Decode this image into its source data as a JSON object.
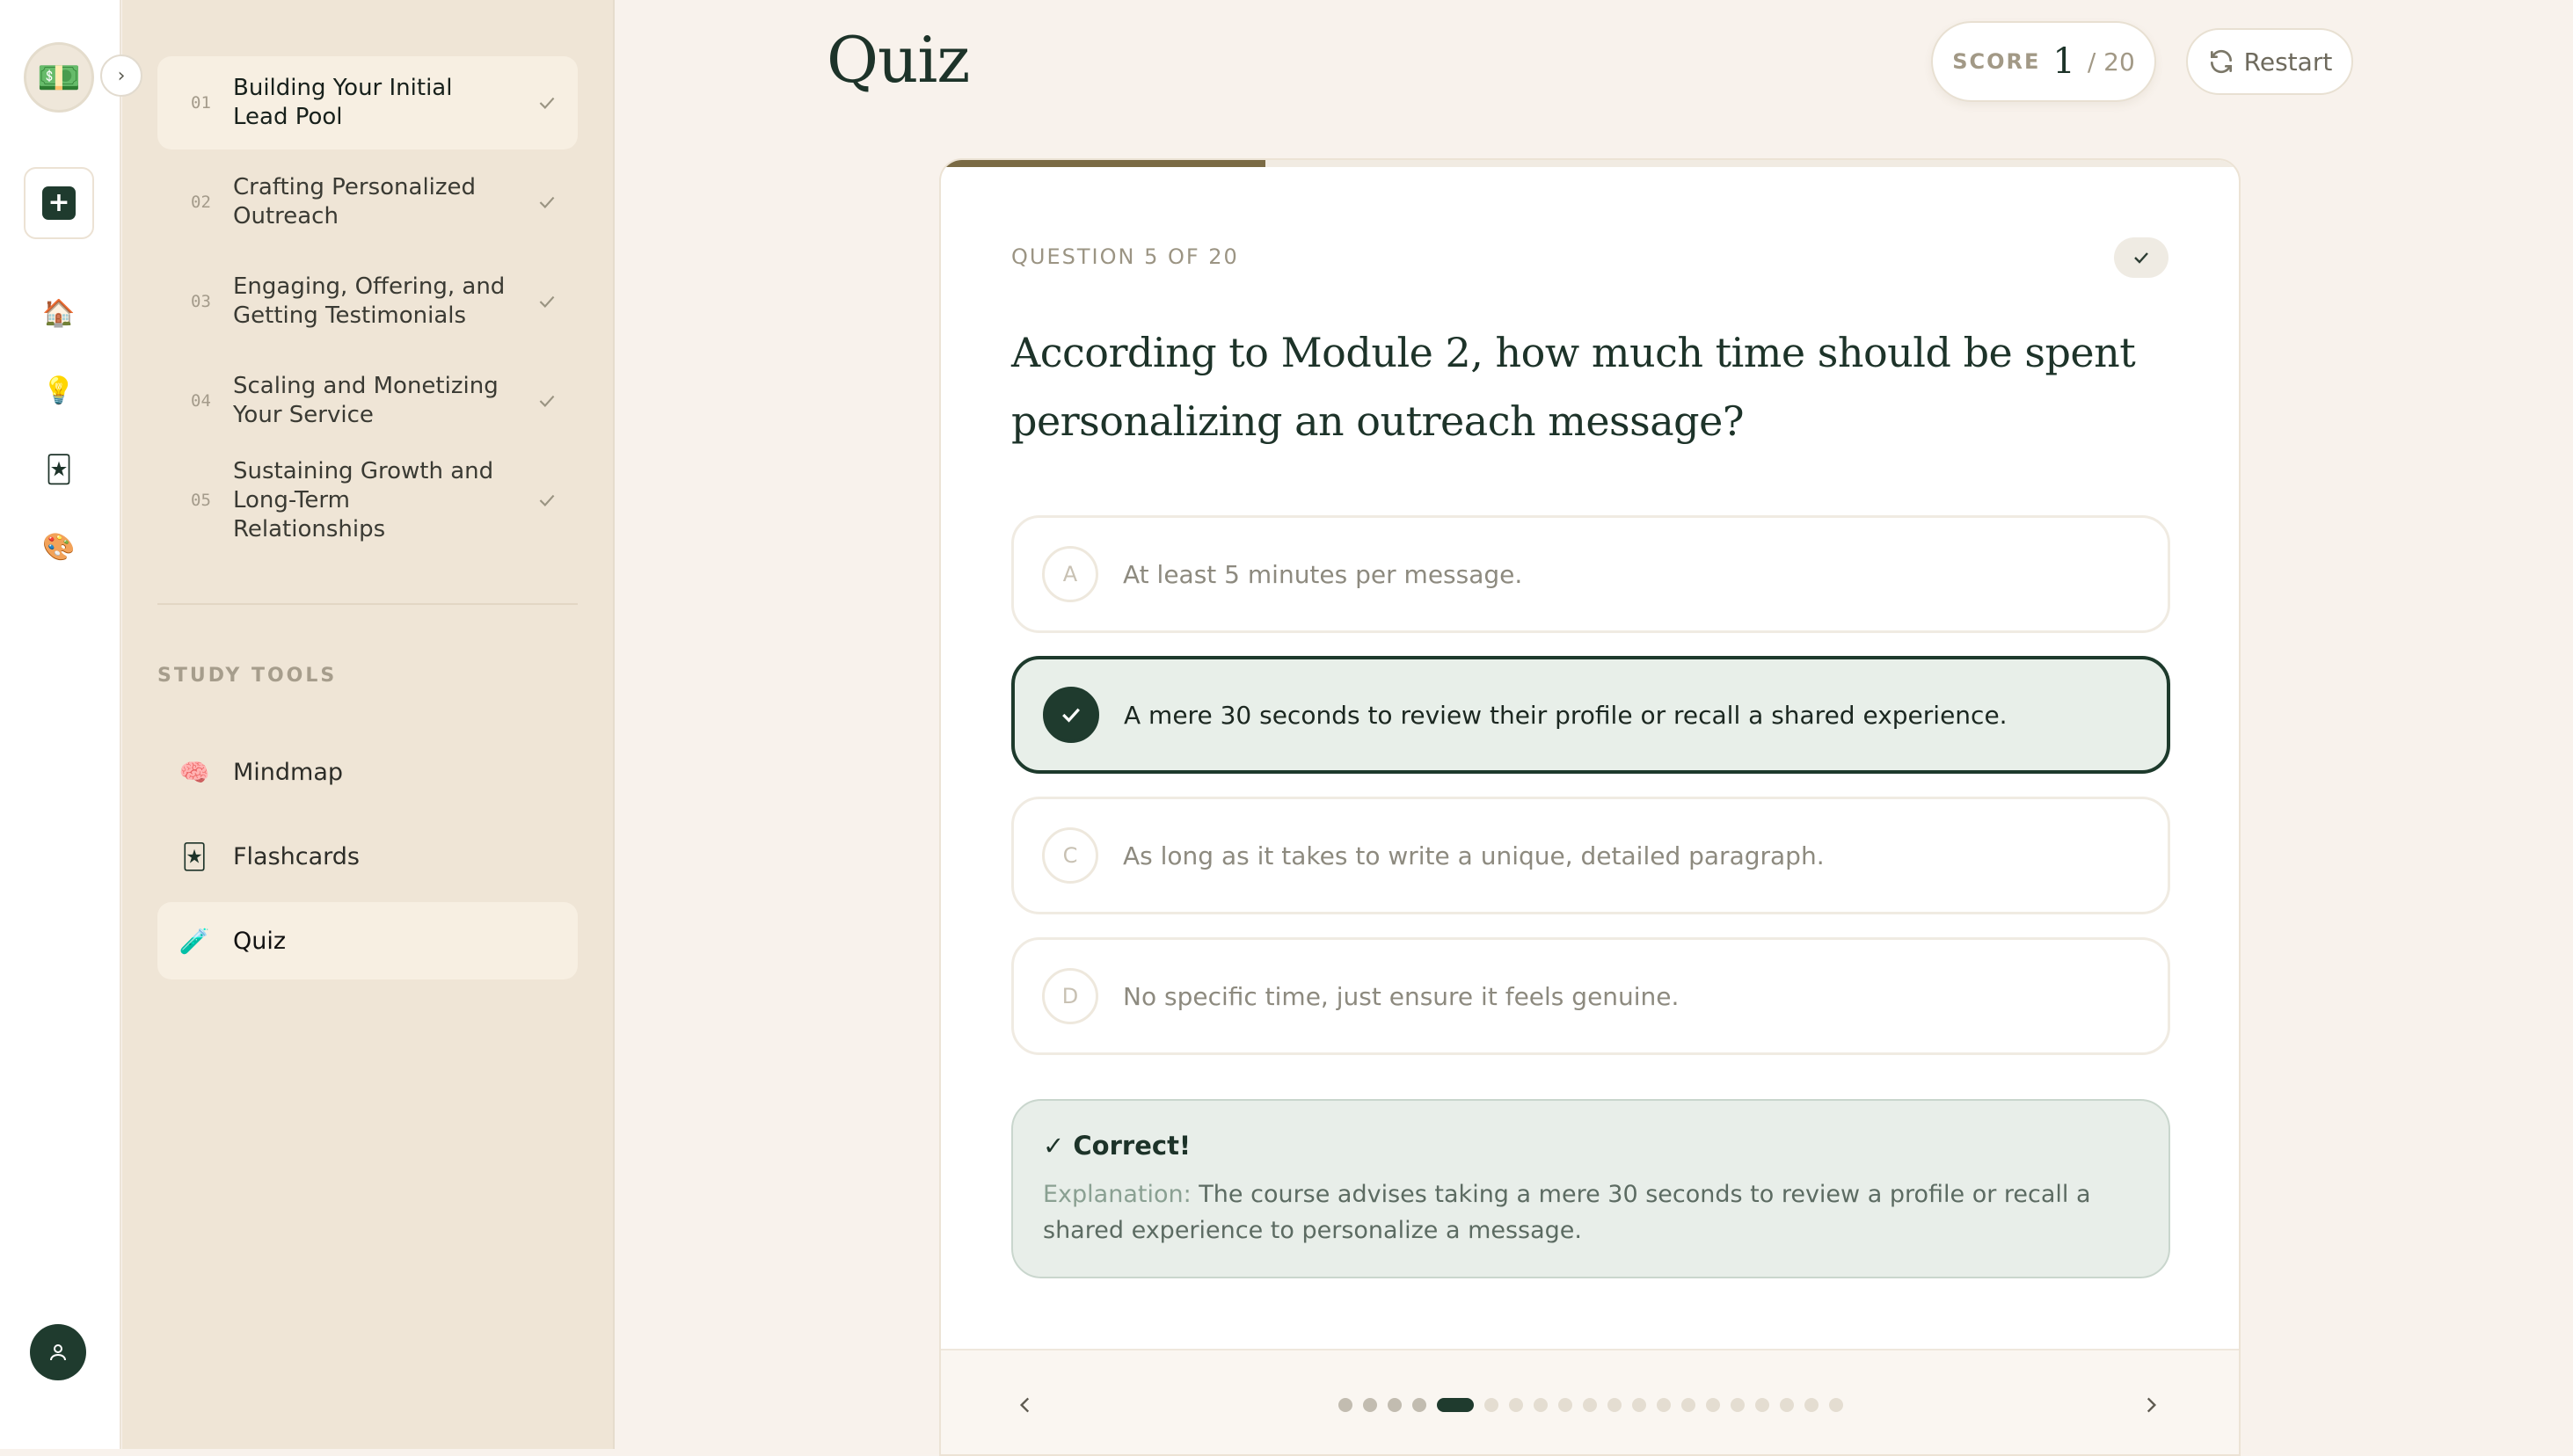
{
  "rail": {
    "logo_glyph": "💵",
    "expand_glyph": "›",
    "new_glyph": "+",
    "icons": [
      "home-icon",
      "lightbulb-icon",
      "flashcard-icon",
      "palette-icon"
    ],
    "icon_glyphs": [
      "🏠",
      "💡",
      "🃏",
      "🎨"
    ]
  },
  "sidebar": {
    "modules": [
      {
        "num": "01",
        "title": "Building Your Initial Lead Pool",
        "completed": true
      },
      {
        "num": "02",
        "title": "Crafting Personalized Outreach",
        "completed": true
      },
      {
        "num": "03",
        "title": "Engaging, Offering, and Getting Testimonials",
        "completed": true
      },
      {
        "num": "04",
        "title": "Scaling and Monetizing Your Service",
        "completed": true
      },
      {
        "num": "05",
        "title": "Sustaining Growth and Long-Term Relationships",
        "completed": true
      }
    ],
    "tools_label": "STUDY TOOLS",
    "tools": [
      {
        "label": "Mindmap",
        "glyph": "🧠"
      },
      {
        "label": "Flashcards",
        "glyph": "🃏"
      },
      {
        "label": "Quiz",
        "glyph": "🧪"
      }
    ]
  },
  "header": {
    "title": "Quiz",
    "score_label": "SCORE",
    "score_value": "1",
    "score_total": "/ 20",
    "restart_label": "Restart"
  },
  "quiz": {
    "progress_fraction": 0.25,
    "counter": "QUESTION 5 OF 20",
    "question": "According to Module 2, how much time should be spent personalizing an outreach message?",
    "options": [
      {
        "letter": "A",
        "text": "At least 5 minutes per message."
      },
      {
        "letter": "B",
        "text": "A mere 30 seconds to review their profile or recall a shared experience."
      },
      {
        "letter": "C",
        "text": "As long as it takes to write a unique, detailed paragraph."
      },
      {
        "letter": "D",
        "text": "No specific time, just ensure it feels genuine."
      }
    ],
    "selected": 1,
    "feedback_title": "✓ Correct!",
    "explanation_label": "Explanation:",
    "explanation": "The course advises taking a mere 30 seconds to review a profile or recall a shared experience to personalize a message.",
    "total_questions": 20,
    "current_index": 4
  },
  "colors": {
    "accent": "#1f3b2e",
    "background": "#f8f2ec",
    "sidebar": "#efe5d6",
    "progress": "#7a6a44"
  }
}
